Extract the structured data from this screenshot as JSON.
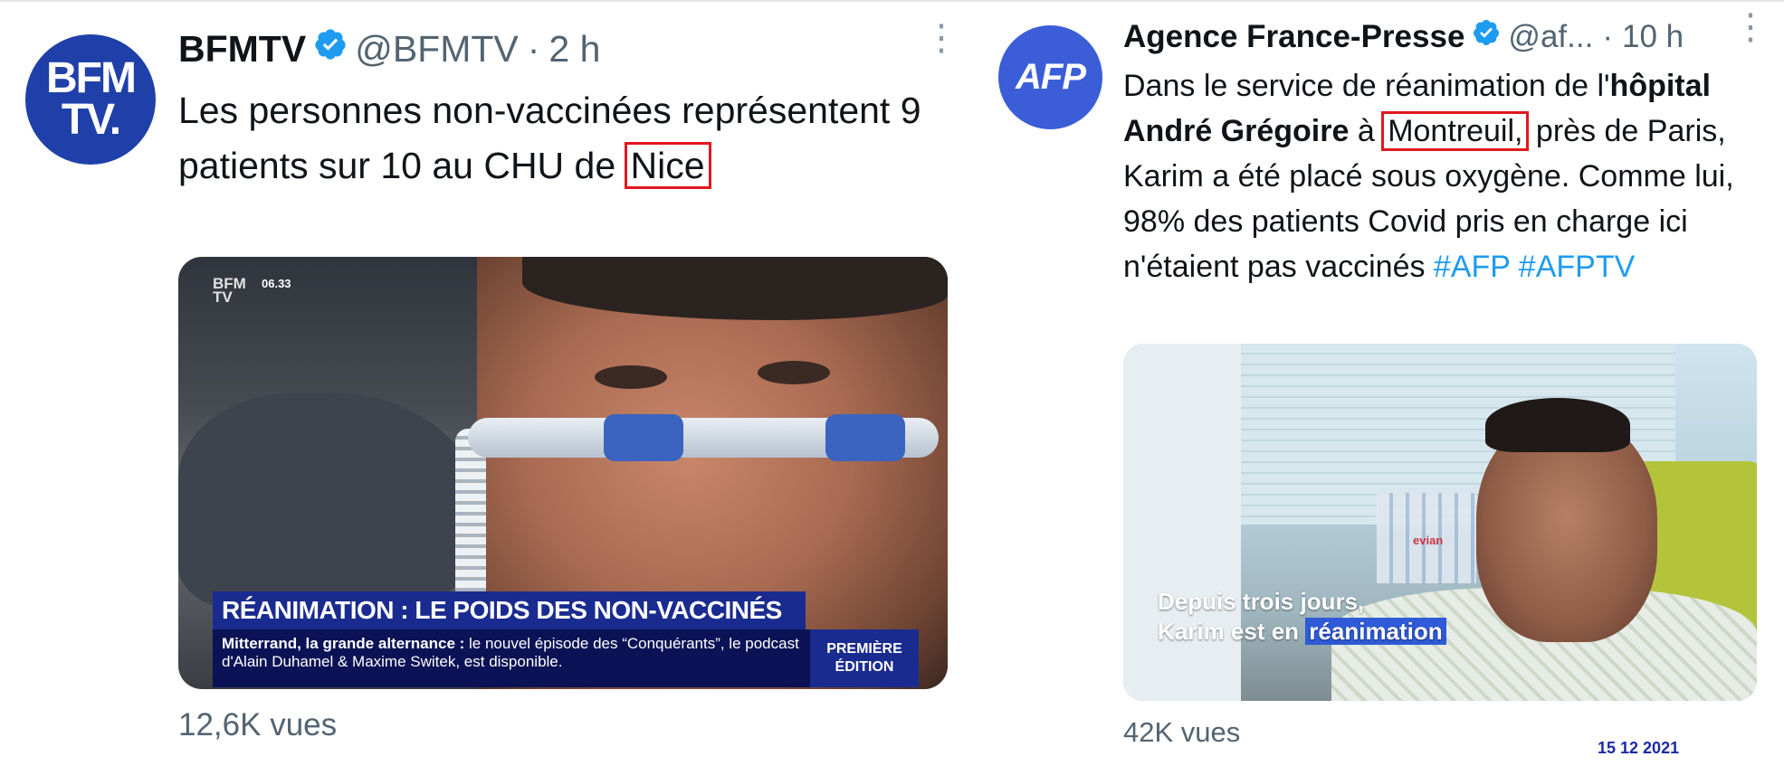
{
  "colors": {
    "bfm_blue": "#1f40a8",
    "afp_blue": "#3b5ed8",
    "highlight_red": "#e2171f",
    "hashtag_blue": "#1d9bf0",
    "verified_blue": "#1d9bf0",
    "muted_gray": "#536471"
  },
  "tweets": {
    "bfm": {
      "avatar_text": "BFM\nTV.",
      "name": "BFMTV",
      "handle": "@BFMTV",
      "separator": "·",
      "time": "2 h",
      "more_icon": "more-vertical-icon",
      "text_part1": "Les personnes non-vaccinées représentent 9 patients sur 10 au CHU de ",
      "text_highlight": "Nice",
      "media": {
        "logo": "BFM\nTV",
        "clock": "06.33",
        "banner": "RÉANIMATION : LE POIDS DES NON-VACCINÉS",
        "ticker_bold": "Mitterrand, la grande alternance :",
        "ticker_text": " le nouvel épisode des “Conquérants”, le podcast d'Alain Duhamel & Maxime Switek, est disponible.",
        "edition": "PREMIÈRE\nÉDITION"
      },
      "views": "12,6K vues"
    },
    "afp": {
      "avatar_text": "AFP",
      "name": "Agence France-Presse",
      "handle": "@af...",
      "separator": "·",
      "time": "10 h",
      "more_icon": "more-vertical-icon",
      "text_1": "Dans le service de réanimation de l'",
      "text_bold": "hôpital André Grégoire",
      "text_2": " à ",
      "text_highlight": "Montreuil,",
      "text_3": " près de Paris, Karim a été placé sous oxygène. Comme lui, 98% des patients Covid pris en charge ici n'étaient pas vaccinés ",
      "hashtag_1": "#AFP",
      "hashtag_2": "#AFPTV",
      "media": {
        "caption_line1": "Depuis trois jours,",
        "caption_line2_prefix": "Karim est en ",
        "caption_line2_highlight": "réanimation",
        "bottle_label": "evian"
      },
      "views": "42K vues",
      "date_stamp": "15 12 2021"
    }
  }
}
